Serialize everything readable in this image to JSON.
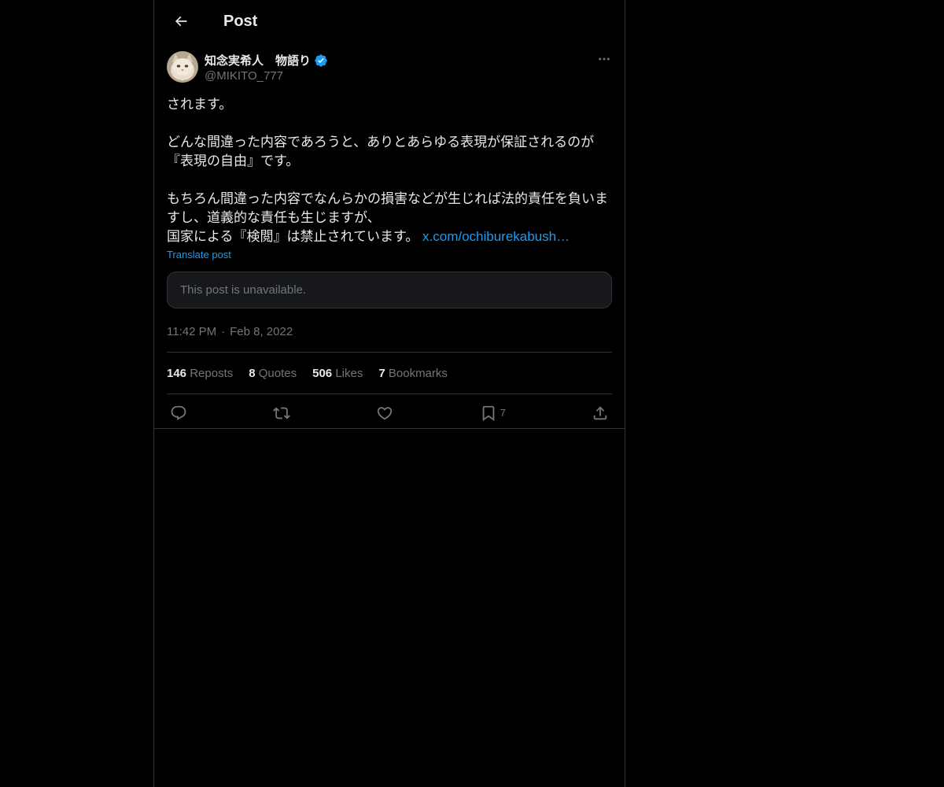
{
  "header": {
    "title": "Post"
  },
  "author": {
    "display_name": "知念実希人　物語り",
    "handle": "@MIKITO_777"
  },
  "post": {
    "text_main": "されます。\n\nどんな間違った内容であろうと、ありとあらゆる表現が保証されるのが『表現の自由』です。\n\nもちろん間違った内容でなんらかの損害などが生じれば法的責任を負いますし、道義的な責任も生じますが、\n国家による『検閲』は禁止されています。 ",
    "link_text": "x.com/ochiburekabush…",
    "translate_label": "Translate post",
    "quoted_unavailable": "This post is unavailable.",
    "time": "11:42 PM",
    "date": "Feb 8, 2022"
  },
  "stats": [
    {
      "num": "146",
      "label": "Reposts"
    },
    {
      "num": "8",
      "label": "Quotes"
    },
    {
      "num": "506",
      "label": "Likes"
    },
    {
      "num": "7",
      "label": "Bookmarks"
    }
  ],
  "actions": {
    "bookmark_count": "7"
  },
  "icons": {
    "back": "arrow-left-icon",
    "verified": "verified-badge-icon",
    "more": "more-icon",
    "reply": "reply-icon",
    "repost": "repost-icon",
    "like": "heart-icon",
    "bookmark": "bookmark-icon",
    "share": "share-icon"
  },
  "colors": {
    "background": "#000000",
    "text": "#e7e9ea",
    "muted": "#71767b",
    "accent": "#1d9bf0",
    "border": "#2f3336"
  }
}
